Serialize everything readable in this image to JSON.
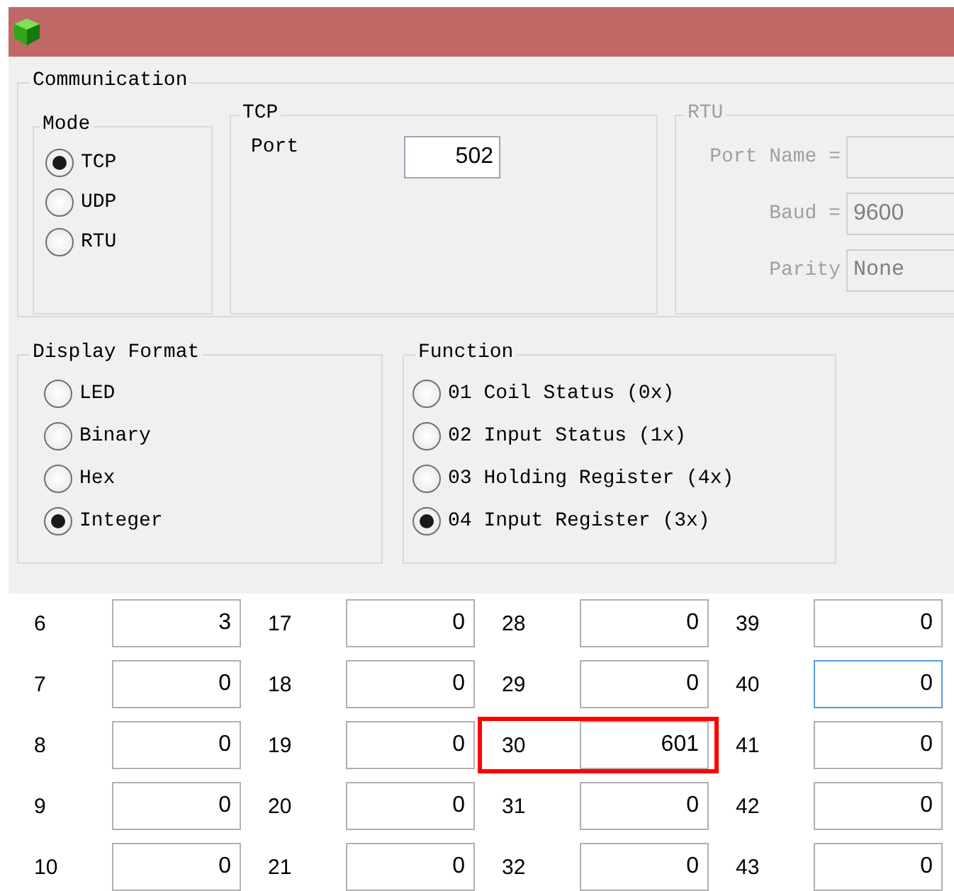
{
  "communication": {
    "title": "Communication",
    "mode": {
      "title": "Mode",
      "options": [
        {
          "label": "TCP",
          "selected": true
        },
        {
          "label": "UDP",
          "selected": false
        },
        {
          "label": "RTU",
          "selected": false
        }
      ]
    },
    "tcp": {
      "title": "TCP",
      "port_label": "Port",
      "port_value": "502"
    },
    "rtu": {
      "title": "RTU",
      "disabled": true,
      "port_name_label": "Port Name =",
      "baud_label": "Baud =",
      "baud_value": "9600",
      "parity_label": "Parity",
      "parity_value": "None"
    }
  },
  "display_format": {
    "title": "Display Format",
    "options": [
      {
        "label": "LED",
        "selected": false
      },
      {
        "label": "Binary",
        "selected": false
      },
      {
        "label": "Hex",
        "selected": false
      },
      {
        "label": "Integer",
        "selected": true
      }
    ]
  },
  "function": {
    "title": "Function",
    "options": [
      {
        "label": "01 Coil Status (0x)",
        "selected": false
      },
      {
        "label": "02 Input Status (1x)",
        "selected": false
      },
      {
        "label": "03 Holding Register (4x)",
        "selected": false
      },
      {
        "label": "04 Input Register (3x)",
        "selected": true
      }
    ]
  },
  "registers": [
    [
      {
        "label": "6",
        "value": "3",
        "focused": false,
        "highlighted": false
      },
      {
        "label": "17",
        "value": "0",
        "focused": false,
        "highlighted": false
      },
      {
        "label": "28",
        "value": "0",
        "focused": false,
        "highlighted": false
      },
      {
        "label": "39",
        "value": "0",
        "focused": false,
        "highlighted": false
      }
    ],
    [
      {
        "label": "7",
        "value": "0",
        "focused": false,
        "highlighted": false
      },
      {
        "label": "18",
        "value": "0",
        "focused": false,
        "highlighted": false
      },
      {
        "label": "29",
        "value": "0",
        "focused": false,
        "highlighted": false
      },
      {
        "label": "40",
        "value": "0",
        "focused": true,
        "highlighted": false
      }
    ],
    [
      {
        "label": "8",
        "value": "0",
        "focused": false,
        "highlighted": false
      },
      {
        "label": "19",
        "value": "0",
        "focused": false,
        "highlighted": false
      },
      {
        "label": "30",
        "value": "601",
        "focused": false,
        "highlighted": true
      },
      {
        "label": "41",
        "value": "0",
        "focused": false,
        "highlighted": false
      }
    ],
    [
      {
        "label": "9",
        "value": "0",
        "focused": false,
        "highlighted": false
      },
      {
        "label": "20",
        "value": "0",
        "focused": false,
        "highlighted": false
      },
      {
        "label": "31",
        "value": "0",
        "focused": false,
        "highlighted": false
      },
      {
        "label": "42",
        "value": "0",
        "focused": false,
        "highlighted": false
      }
    ],
    [
      {
        "label": "10",
        "value": "0",
        "focused": false,
        "highlighted": false
      },
      {
        "label": "21",
        "value": "0",
        "focused": false,
        "highlighted": false
      },
      {
        "label": "32",
        "value": "0",
        "focused": false,
        "highlighted": false
      },
      {
        "label": "43",
        "value": "0",
        "focused": false,
        "highlighted": false
      }
    ]
  ]
}
